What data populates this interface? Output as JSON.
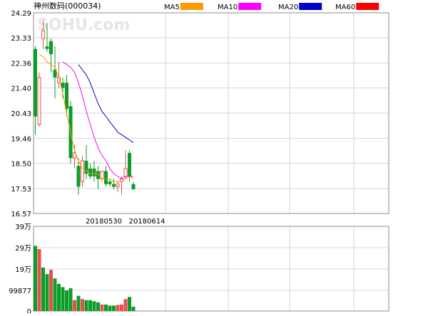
{
  "title": "神州数码(000034)",
  "watermark": "SOHU.com",
  "colors": {
    "up": "#e8504f",
    "down": "#0d9d29",
    "grid": "#d4d4d4",
    "frame": "#8c8c8c",
    "text": "#000000",
    "watermark": "#e6e6e6"
  },
  "legend": [
    {
      "label": "MA5",
      "color": "#ff9900"
    },
    {
      "label": "MA10",
      "color": "#ff00ff"
    },
    {
      "label": "MA20",
      "color": "#0000cc"
    },
    {
      "label": "MA60",
      "color": "#ff0000"
    }
  ],
  "chart_data": [
    {
      "type": "candlestick",
      "title": "神州数码(000034)",
      "y_axis": {
        "ylim": [
          16.57,
          24.29
        ],
        "tick_labels": [
          "24.29",
          "23.33",
          "22.36",
          "21.40",
          "20.43",
          "19.46",
          "18.50",
          "17.53",
          "16.57"
        ]
      },
      "x_axis": {
        "labels": [
          {
            "text": "20180530",
            "index": 16
          },
          {
            "text": "20180614",
            "index": 27
          }
        ]
      },
      "candles": [
        {
          "o": 20.3,
          "h": 23.0,
          "l": 19.6,
          "c": 22.9,
          "up": false
        },
        {
          "o": 20.0,
          "h": 22.0,
          "l": 19.9,
          "c": 21.8,
          "up": true
        },
        {
          "o": 23.3,
          "h": 24.0,
          "l": 22.9,
          "c": 23.6,
          "up": true
        },
        {
          "o": 22.9,
          "h": 23.9,
          "l": 22.8,
          "c": 23.0,
          "up": false
        },
        {
          "o": 22.7,
          "h": 23.3,
          "l": 22.0,
          "c": 23.2,
          "up": false
        },
        {
          "o": 22.1,
          "h": 23.0,
          "l": 21.0,
          "c": 21.8,
          "up": false
        },
        {
          "o": 21.8,
          "h": 22.4,
          "l": 21.4,
          "c": 21.6,
          "up": true
        },
        {
          "o": 21.4,
          "h": 21.8,
          "l": 21.0,
          "c": 21.6,
          "up": false
        },
        {
          "o": 21.6,
          "h": 21.9,
          "l": 20.3,
          "c": 20.6,
          "up": false
        },
        {
          "o": 20.7,
          "h": 20.9,
          "l": 18.5,
          "c": 18.7,
          "up": false
        },
        {
          "o": 18.7,
          "h": 19.2,
          "l": 18.3,
          "c": 18.9,
          "up": true
        },
        {
          "o": 18.4,
          "h": 18.7,
          "l": 17.3,
          "c": 17.6,
          "up": false
        },
        {
          "o": 17.8,
          "h": 18.8,
          "l": 17.6,
          "c": 18.6,
          "up": true
        },
        {
          "o": 18.6,
          "h": 19.2,
          "l": 17.9,
          "c": 18.1,
          "up": false
        },
        {
          "o": 18.0,
          "h": 18.5,
          "l": 17.9,
          "c": 18.3,
          "up": false
        },
        {
          "o": 18.3,
          "h": 18.6,
          "l": 17.8,
          "c": 18.0,
          "up": false
        },
        {
          "o": 18.2,
          "h": 18.4,
          "l": 17.5,
          "c": 17.9,
          "up": false
        },
        {
          "o": 17.9,
          "h": 18.2,
          "l": 17.8,
          "c": 18.2,
          "up": true
        },
        {
          "o": 18.2,
          "h": 18.4,
          "l": 17.6,
          "c": 17.7,
          "up": false
        },
        {
          "o": 17.8,
          "h": 17.9,
          "l": 17.6,
          "c": 17.7,
          "up": false
        },
        {
          "o": 17.7,
          "h": 17.9,
          "l": 17.5,
          "c": 17.6,
          "up": false
        },
        {
          "o": 17.6,
          "h": 17.8,
          "l": 17.4,
          "c": 17.7,
          "up": true
        },
        {
          "o": 17.9,
          "h": 18.0,
          "l": 17.3,
          "c": 17.8,
          "up": true
        },
        {
          "o": 18.0,
          "h": 19.0,
          "l": 17.9,
          "c": 18.3,
          "up": true
        },
        {
          "o": 18.0,
          "h": 19.0,
          "l": 17.8,
          "c": 18.9,
          "up": false
        },
        {
          "o": 17.7,
          "h": 17.8,
          "l": 17.5,
          "c": 17.5,
          "up": false
        }
      ],
      "ma": {
        "MA5": [
          22.7,
          22.6,
          22.4,
          22.3,
          22.2,
          21.8,
          21.2,
          20.4,
          19.7,
          19.0,
          18.6,
          18.3,
          18.2,
          18.1,
          18.1,
          18.1,
          17.9,
          17.9,
          17.9,
          17.8,
          17.8,
          17.8,
          17.9,
          18.0,
          17.9
        ],
        "MA10": [
          22.4,
          22.3,
          22.2,
          22.0,
          21.6,
          21.1,
          20.5,
          20.0,
          19.5,
          19.1,
          18.8,
          18.6,
          18.3,
          18.1,
          18.0,
          17.9,
          18.0,
          18.0,
          18.0
        ],
        "MA20": [
          22.3,
          22.1,
          21.9,
          21.6,
          21.2,
          20.8,
          20.5,
          20.3,
          20.1,
          19.9,
          19.7,
          19.6,
          19.5,
          19.4,
          19.3
        ]
      },
      "volume": {
        "tick_labels": [
          "39万",
          "29万",
          "19万",
          "99877",
          "0"
        ],
        "ylim": [
          0,
          390000
        ],
        "bars": [
          {
            "v": 300000,
            "up": false
          },
          {
            "v": 285000,
            "up": true
          },
          {
            "v": 200000,
            "up": false
          },
          {
            "v": 170000,
            "up": false
          },
          {
            "v": 190000,
            "up": true
          },
          {
            "v": 150000,
            "up": false
          },
          {
            "v": 125000,
            "up": false
          },
          {
            "v": 110000,
            "up": false
          },
          {
            "v": 95000,
            "up": false
          },
          {
            "v": 105000,
            "up": false
          },
          {
            "v": 50000,
            "up": true
          },
          {
            "v": 70000,
            "up": false
          },
          {
            "v": 55000,
            "up": true
          },
          {
            "v": 50000,
            "up": false
          },
          {
            "v": 50000,
            "up": false
          },
          {
            "v": 45000,
            "up": false
          },
          {
            "v": 40000,
            "up": false
          },
          {
            "v": 30000,
            "up": true
          },
          {
            "v": 30000,
            "up": false
          },
          {
            "v": 25000,
            "up": false
          },
          {
            "v": 25000,
            "up": false
          },
          {
            "v": 28000,
            "up": true
          },
          {
            "v": 30000,
            "up": true
          },
          {
            "v": 55000,
            "up": true
          },
          {
            "v": 65000,
            "up": false
          },
          {
            "v": 20000,
            "up": false
          }
        ]
      }
    }
  ]
}
